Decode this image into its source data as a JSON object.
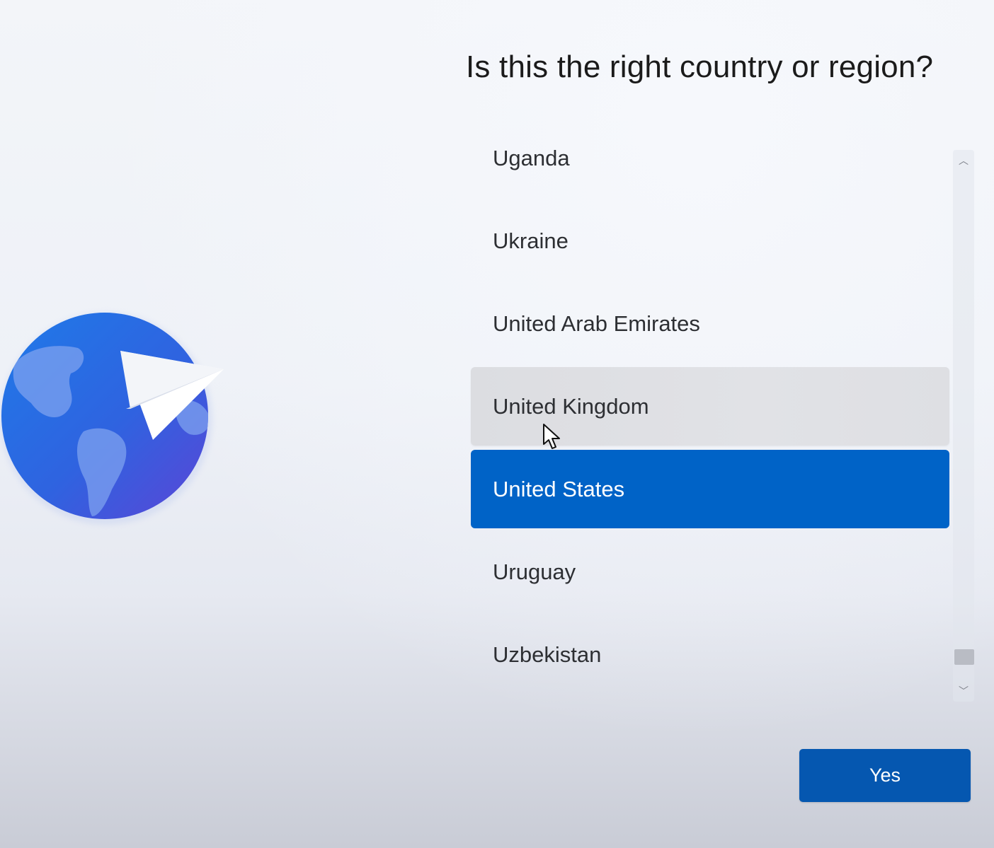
{
  "page": {
    "title": "Is this the right country or region?"
  },
  "illustration": {
    "icon": "globe-with-paper-plane-icon"
  },
  "country_list": {
    "items": [
      {
        "label": "Uganda",
        "state": "normal"
      },
      {
        "label": "Ukraine",
        "state": "normal"
      },
      {
        "label": "United Arab Emirates",
        "state": "normal"
      },
      {
        "label": "United Kingdom",
        "state": "hover"
      },
      {
        "label": "United States",
        "state": "selected"
      },
      {
        "label": "Uruguay",
        "state": "normal"
      },
      {
        "label": "Uzbekistan",
        "state": "normal"
      }
    ],
    "selected": "United States"
  },
  "scrollbar": {
    "up_icon": "chevron-up-icon",
    "down_icon": "chevron-down-icon",
    "up_glyph": "︿",
    "down_glyph": "﹀"
  },
  "actions": {
    "yes_label": "Yes"
  },
  "colors": {
    "accent": "#0063c7",
    "button": "#0557b0",
    "hover": "#dedfe3"
  }
}
